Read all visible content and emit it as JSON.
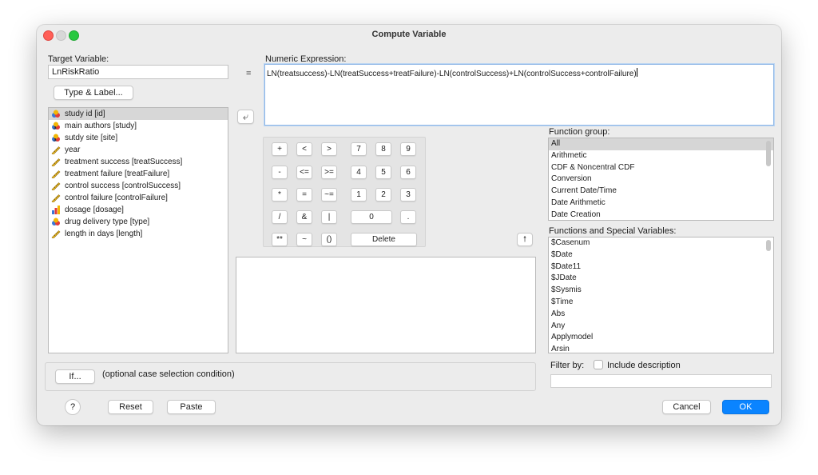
{
  "window": {
    "title": "Compute Variable",
    "traffic_lights": [
      "#ff5f57",
      "#d8d8d8",
      "#28c840"
    ]
  },
  "target": {
    "label": "Target Variable:",
    "value": "LnRiskRatio",
    "type_label_button": "Type & Label...",
    "equals": "="
  },
  "expression": {
    "label": "Numeric Expression:",
    "value": "LN(treatsuccess)-LN(treatSuccess+treatFailure)-LN(controlSuccess)+LN(controlSuccess+controlFailure)"
  },
  "variables": [
    {
      "label": "study id [id]",
      "icon": "nominal-icon",
      "selected": true
    },
    {
      "label": "main authors [study]",
      "icon": "nominal-string-icon"
    },
    {
      "label": "sutdy site [site]",
      "icon": "nominal-string-icon"
    },
    {
      "label": "year",
      "icon": "scale-ruler-icon"
    },
    {
      "label": "treatment success [treatSuccess]",
      "icon": "scale-ruler-icon"
    },
    {
      "label": "treatment failure [treatFailure]",
      "icon": "scale-ruler-icon"
    },
    {
      "label": "control success [controlSuccess]",
      "icon": "scale-ruler-icon"
    },
    {
      "label": "control failure [controlFailure]",
      "icon": "scale-ruler-icon"
    },
    {
      "label": "dosage [dosage]",
      "icon": "ordinal-bars-icon"
    },
    {
      "label": "drug delivery type [type]",
      "icon": "nominal-icon"
    },
    {
      "label": "length in days [length]",
      "icon": "scale-ruler-icon"
    }
  ],
  "keypad": {
    "keys": [
      "+",
      "<",
      ">",
      "7",
      "8",
      "9",
      "-",
      "<=",
      ">=",
      "4",
      "5",
      "6",
      "*",
      "=",
      "~=",
      "1",
      "2",
      "3",
      "/",
      "&",
      "|",
      "0",
      ".",
      "**",
      "~",
      "()",
      "Delete"
    ]
  },
  "function_group": {
    "label": "Function group:",
    "items": [
      "All",
      "Arithmetic",
      "CDF & Noncentral CDF",
      "Conversion",
      "Current Date/Time",
      "Date Arithmetic",
      "Date Creation"
    ],
    "selected_index": 0
  },
  "functions": {
    "label": "Functions and Special Variables:",
    "items": [
      "$Casenum",
      "$Date",
      "$Date11",
      "$JDate",
      "$Sysmis",
      "$Time",
      "Abs",
      "Any",
      "Applymodel",
      "Arsin"
    ]
  },
  "if_section": {
    "button": "If...",
    "text": "(optional case selection condition)"
  },
  "filter": {
    "label": "Filter by:",
    "checkbox_label": "Include description",
    "checked": false
  },
  "footer": {
    "help": "?",
    "reset": "Reset",
    "paste": "Paste",
    "cancel": "Cancel",
    "ok": "OK"
  },
  "colors": {
    "accent": "#0a84ff",
    "window_bg": "#ececec",
    "selection_bg": "#d6d6d6"
  }
}
